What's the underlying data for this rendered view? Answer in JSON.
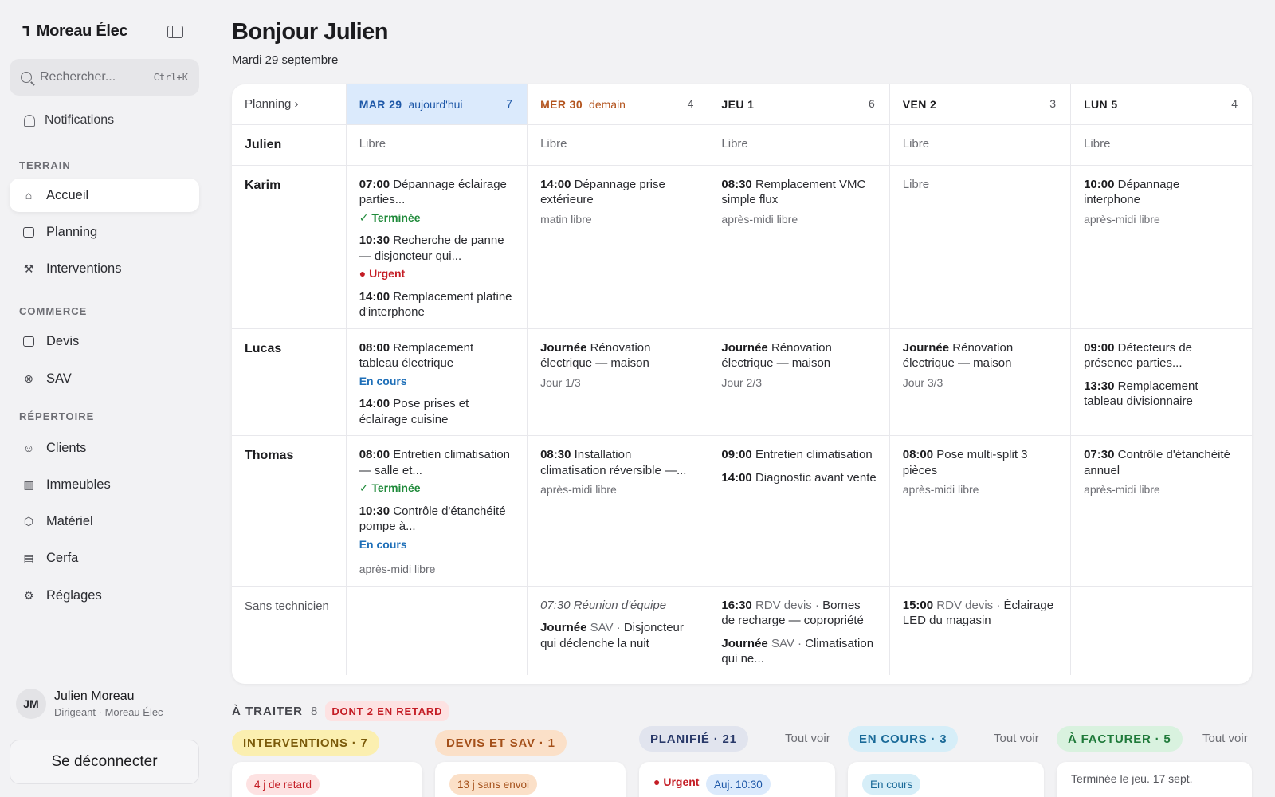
{
  "sidebar": {
    "brand": "Moreau Élec",
    "search_placeholder": "Rechercher...",
    "search_shortcut": "Ctrl+K",
    "notifications": "Notifications",
    "sections": [
      {
        "label": "TERRAIN",
        "items": [
          "Accueil",
          "Planning",
          "Interventions"
        ]
      },
      {
        "label": "COMMERCE",
        "items": [
          "Devis",
          "SAV"
        ]
      },
      {
        "label": "RÉPERTOIRE",
        "items": [
          "Clients",
          "Immeubles",
          "Matériel",
          "Cerfa",
          "Réglages"
        ]
      }
    ],
    "active_item": "Accueil",
    "user": {
      "initials": "JM",
      "name": "Julien Moreau",
      "role": "Dirigeant · Moreau Élec"
    },
    "logout": "Se déconnecter"
  },
  "header": {
    "title": "Bonjour Julien",
    "date": "Mardi 29 septembre"
  },
  "planning": {
    "corner_label": "Planning ›",
    "days": [
      {
        "label": "MAR 29",
        "rel": "aujourd'hui",
        "count": "7"
      },
      {
        "label": "MER 30",
        "rel": "demain",
        "count": "4"
      },
      {
        "label": "JEU 1",
        "rel": "",
        "count": "6"
      },
      {
        "label": "VEN 2",
        "rel": "",
        "count": "3"
      },
      {
        "label": "LUN 5",
        "rel": "",
        "count": "4"
      }
    ],
    "free_label": "Libre",
    "rows": [
      {
        "tech": "Julien",
        "cells": [
          [
            {
              "free": "Libre"
            }
          ],
          [
            {
              "free": "Libre"
            }
          ],
          [
            {
              "free": "Libre"
            }
          ],
          [
            {
              "free": "Libre"
            }
          ],
          [
            {
              "free": "Libre"
            }
          ]
        ]
      },
      {
        "tech": "Karim",
        "cells": [
          [
            {
              "time": "07:00",
              "text": "Dépannage éclairage parties...",
              "status": "✓ Terminée",
              "status_kind": "done"
            },
            {
              "time": "10:30",
              "text": "Recherche de panne — disjoncteur qui...",
              "status": "● Urgent",
              "status_kind": "urgent"
            },
            {
              "time": "14:00",
              "text": "Remplacement platine d'interphone"
            }
          ],
          [
            {
              "time": "14:00",
              "text": "Dépannage prise extérieure",
              "sub": "matin libre"
            }
          ],
          [
            {
              "time": "08:30",
              "text": "Remplacement VMC simple flux",
              "sub": "après-midi libre"
            }
          ],
          [
            {
              "free": "Libre"
            }
          ],
          [
            {
              "time": "10:00",
              "text": "Dépannage interphone",
              "sub": "après-midi libre"
            }
          ]
        ]
      },
      {
        "tech": "Lucas",
        "cells": [
          [
            {
              "time": "08:00",
              "text": "Remplacement tableau électrique",
              "status": "En cours",
              "status_kind": "cours"
            },
            {
              "time": "14:00",
              "text": "Pose prises et éclairage cuisine"
            }
          ],
          [
            {
              "time": "Journée",
              "text": "Rénovation électrique — maison",
              "sub": "Jour 1/3"
            }
          ],
          [
            {
              "time": "Journée",
              "text": "Rénovation électrique — maison",
              "sub": "Jour 2/3"
            }
          ],
          [
            {
              "time": "Journée",
              "text": "Rénovation électrique — maison",
              "sub": "Jour 3/3"
            }
          ],
          [
            {
              "time": "09:00",
              "text": "Détecteurs de présence parties..."
            },
            {
              "time": "13:30",
              "text": "Remplacement tableau divisionnaire"
            }
          ]
        ]
      },
      {
        "tech": "Thomas",
        "cells": [
          [
            {
              "time": "08:00",
              "text": "Entretien climatisation — salle et...",
              "status": "✓ Terminée",
              "status_kind": "done"
            },
            {
              "time": "10:30",
              "text": "Contrôle d'étanchéité pompe à...",
              "status": "En cours",
              "status_kind": "cours",
              "sub": "après-midi libre"
            }
          ],
          [
            {
              "time": "08:30",
              "text": "Installation climatisation réversible —...",
              "sub": "après-midi libre"
            }
          ],
          [
            {
              "time": "09:00",
              "text": "Entretien climatisation"
            },
            {
              "time": "14:00",
              "text": "Diagnostic avant vente"
            }
          ],
          [
            {
              "time": "08:00",
              "text": "Pose multi-split 3 pièces",
              "sub": "après-midi libre"
            }
          ],
          [
            {
              "time": "07:30",
              "text": "Contrôle d'étanchéité annuel",
              "sub": "après-midi libre"
            }
          ]
        ]
      },
      {
        "tech": "Sans technicien",
        "cells": [
          [],
          [
            {
              "italic": "07:30 Réunion d'équipe"
            },
            {
              "time": "Journée",
              "kind": "SAV ·",
              "text": "Disjoncteur qui déclenche la nuit"
            }
          ],
          [
            {
              "time": "16:30",
              "kind": "RDV devis ·",
              "text": "Bornes de recharge — copropriété"
            },
            {
              "time": "Journée",
              "kind": "SAV ·",
              "text": "Climatisation qui ne..."
            }
          ],
          [
            {
              "time": "15:00",
              "kind": "RDV devis ·",
              "text": "Éclairage LED du magasin"
            }
          ],
          []
        ]
      }
    ]
  },
  "todo": {
    "label": "À TRAITER",
    "count": "8",
    "late": "DONT 2 EN RETARD",
    "columns": [
      {
        "pill": "INTERVENTIONS · 7",
        "see_all": "",
        "chip": "4 j de retard"
      },
      {
        "pill": "DEVIS ET SAV · 1",
        "see_all": "",
        "chip": "13 j sans envoi"
      },
      {
        "pill": "PLANIFIÉ · 21",
        "see_all": "Tout voir",
        "urgent": "● Urgent",
        "chip": "Auj. 10:30"
      },
      {
        "pill": "EN COURS · 3",
        "see_all": "Tout voir",
        "chip": "En cours"
      },
      {
        "pill": "À FACTURER · 5",
        "see_all": "Tout voir",
        "note": "Terminée le jeu. 17 sept."
      }
    ]
  },
  "colors": {
    "today_bg": "#dbeafc",
    "today_text": "#1e58a8",
    "tomorrow_text": "#b3541e",
    "done": "#1f8a3a",
    "urgent": "#c41d25",
    "in_progress": "#1e6fb8"
  },
  "icons": {
    "brand": "logo-mark-icon",
    "sidebar_toggle": "sidebar-toggle-icon",
    "search": "search-icon",
    "notifications": "bell-icon",
    "Accueil": "home-icon",
    "Planning": "calendar-icon",
    "Interventions": "wrench-icon",
    "Devis": "briefcase-icon",
    "SAV": "support-icon",
    "Clients": "users-icon",
    "Immeubles": "building-icon",
    "Matériel": "box-icon",
    "Cerfa": "document-icon",
    "Réglages": "gear-icon"
  }
}
